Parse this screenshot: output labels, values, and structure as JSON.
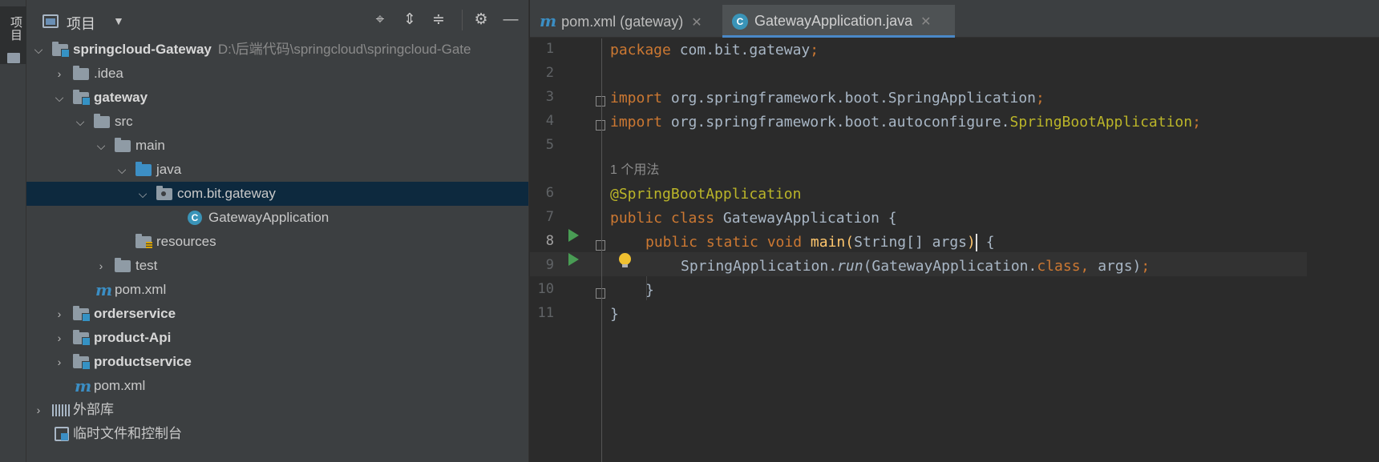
{
  "toolstrip": {
    "label": "项目"
  },
  "project": {
    "title": "项目",
    "tree": [
      {
        "label": "springcloud-Gateway",
        "path": "D:\\后端代码\\springcloud\\springcloud-Gate"
      },
      {
        "label": ".idea"
      },
      {
        "label": "gateway"
      },
      {
        "label": "src"
      },
      {
        "label": "main"
      },
      {
        "label": "java"
      },
      {
        "label": "com.bit.gateway"
      },
      {
        "label": "GatewayApplication"
      },
      {
        "label": "resources"
      },
      {
        "label": "test"
      },
      {
        "label": "pom.xml"
      },
      {
        "label": "orderservice"
      },
      {
        "label": "product-Api"
      },
      {
        "label": "productservice"
      },
      {
        "label": "pom.xml"
      },
      {
        "label": "外部库"
      },
      {
        "label": "临时文件和控制台"
      }
    ]
  },
  "editor": {
    "tabs": [
      {
        "label": "pom.xml (gateway)",
        "icon": "maven-icon"
      },
      {
        "label": "GatewayApplication.java",
        "icon": "class-icon"
      }
    ],
    "line_numbers": [
      "1",
      "2",
      "3",
      "4",
      "5",
      "6",
      "7",
      "8",
      "9",
      "10",
      "11"
    ],
    "usage_hint": "1 个用法",
    "code": {
      "l1_kw": "package",
      "l1_rest": " com.bit.gateway",
      "semi": ";",
      "l3_kw": "import",
      "l3_rest": " org.springframework.boot.SpringApplication",
      "l4_kw": "import",
      "l4_rest": " org.springframework.boot.autoconfigure.",
      "l4_ann": "SpringBootApplication",
      "l6_ann": "@SpringBootApplication",
      "l7_kw": "public class",
      "l7_rest": " GatewayApplication {",
      "l8_kw": "public static void",
      "l8_fn": "main",
      "l8_open": "(",
      "l8_params": "String[] args",
      "l8_close": ")",
      "l8_brace": " {",
      "l9_cls": "SpringApplication.",
      "l9_fn": "run",
      "l9_args1": "(GatewayApplication.",
      "l9_kw": "class",
      "l9_comma": ",",
      "l9_args2": " args)",
      "l10": "}",
      "l11": "}"
    }
  }
}
